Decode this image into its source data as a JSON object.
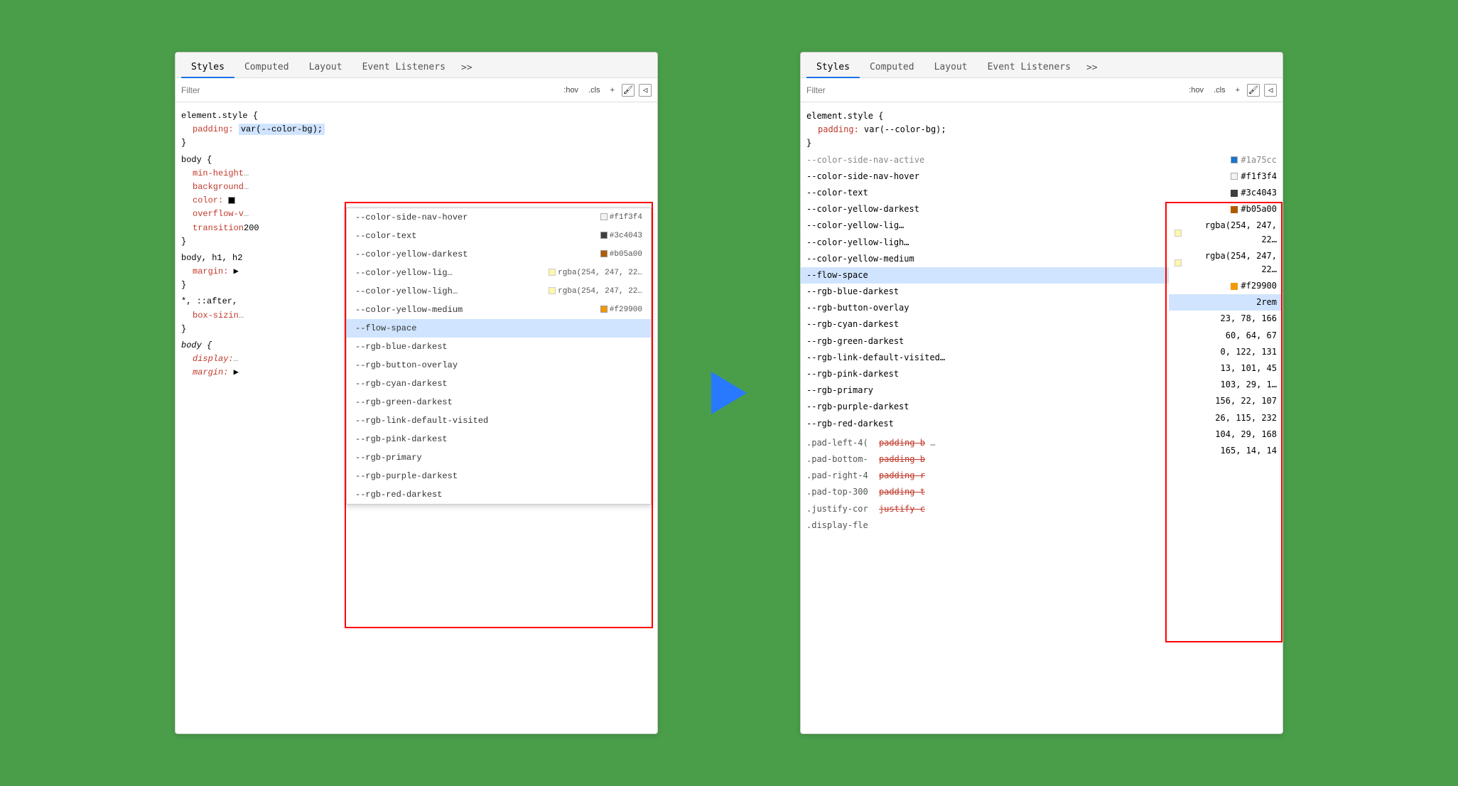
{
  "left_panel": {
    "tabs": [
      "Styles",
      "Computed",
      "Layout",
      "Event Listeners",
      ">>"
    ],
    "active_tab": "Styles",
    "filter_placeholder": "Filter",
    "filter_buttons": [
      ":hov",
      ".cls",
      "+"
    ],
    "styles_content": [
      {
        "type": "rule",
        "selector": "element.style {",
        "props": [
          {
            "name": "padding:",
            "value": "var(--color-bg);",
            "highlight": true
          }
        ],
        "close": "}"
      },
      {
        "type": "rule",
        "selector": "body {",
        "props": [
          {
            "name": "min-height",
            "value": "",
            "truncated": true
          },
          {
            "name": "background",
            "value": "",
            "truncated": true
          },
          {
            "name": "color:",
            "value": "■",
            "truncated": true
          },
          {
            "name": "overflow-v",
            "value": "",
            "truncated": true
          },
          {
            "name": "transition",
            "value": "200",
            "truncated": true
          }
        ],
        "close": "}"
      },
      {
        "type": "rule",
        "selector": "body, h1, h2",
        "props": [
          {
            "name": "margin:",
            "value": "▶",
            "truncated": true
          }
        ],
        "close": "}"
      },
      {
        "type": "rule",
        "selector": "*, ::after,",
        "props": [
          {
            "name": "box-sizin",
            "value": "",
            "truncated": true
          }
        ],
        "close": "}"
      },
      {
        "type": "rule",
        "selector": "body {",
        "italic": true,
        "props": [
          {
            "name": "display:",
            "value": "",
            "truncated": true
          },
          {
            "name": "margin:",
            "value": "▶",
            "truncated": true
          }
        ]
      }
    ],
    "autocomplete": {
      "items": [
        {
          "name": "--color-side-nav-hover",
          "value": "#f1f3f4",
          "swatch": "#f1f3f4",
          "swatch_border": true
        },
        {
          "name": "--color-text",
          "value": "#3c4043",
          "swatch": "#3c4043",
          "swatch_border": false
        },
        {
          "name": "--color-yellow-darkest",
          "value": "#b05a00",
          "swatch": "#b05a00",
          "swatch_border": false
        },
        {
          "name": "--color-yellow-lig…",
          "value": "rgba(254, 247, 22…",
          "swatch": "#fef722",
          "swatch_border": true
        },
        {
          "name": "--color-yellow-ligh…",
          "value": "rgba(254, 247, 22…",
          "swatch": "#fef722",
          "swatch_border": true
        },
        {
          "name": "--color-yellow-medium",
          "value": "#f29900",
          "swatch": "#f29900",
          "swatch_border": false
        },
        {
          "name": "--flow-space",
          "value": "",
          "highlighted": true
        },
        {
          "name": "--rgb-blue-darkest",
          "value": ""
        },
        {
          "name": "--rgb-button-overlay",
          "value": ""
        },
        {
          "name": "--rgb-cyan-darkest",
          "value": ""
        },
        {
          "name": "--rgb-green-darkest",
          "value": ""
        },
        {
          "name": "--rgb-link-default-visited",
          "value": ""
        },
        {
          "name": "--rgb-pink-darkest",
          "value": ""
        },
        {
          "name": "--rgb-primary",
          "value": ""
        },
        {
          "name": "--rgb-purple-darkest",
          "value": ""
        },
        {
          "name": "--rgb-red-darkest",
          "value": ""
        }
      ]
    }
  },
  "right_panel": {
    "tabs": [
      "Styles",
      "Computed",
      "Layout",
      "Event Listeners",
      ">>"
    ],
    "active_tab": "Styles",
    "filter_placeholder": "Filter",
    "filter_buttons": [
      ":hov",
      ".cls",
      "+"
    ],
    "styles_top": [
      {
        "selector": "element.style {",
        "props": [
          {
            "name": "padding:",
            "value": "var(--color-bg);"
          }
        ],
        "close": "}"
      }
    ],
    "computed_rows_top": [
      {
        "name": "--color-side-nav-active",
        "value": "#1a75cc",
        "swatch": "#1a75cc",
        "truncated": true
      },
      {
        "name": "--color-side-nav-hover",
        "value": "#f1f3f4",
        "swatch": "#f1f3f4",
        "swatch_border": true
      },
      {
        "name": "--color-text",
        "value": "#3c4043",
        "swatch": "#3c4043"
      },
      {
        "name": "--color-yellow-darkest",
        "value": "#b05a00",
        "swatch": "#b05a00"
      },
      {
        "name": "--color-yellow-lig…",
        "value": "rgba(254, 247, 22…",
        "swatch": "#fef722",
        "swatch_border": true
      },
      {
        "name": "--color-yellow-ligh…",
        "value": "rgba(254, 247, 22…",
        "swatch": "#fef722",
        "swatch_border": true
      },
      {
        "name": "--color-yellow-medium",
        "value": "#f29900",
        "swatch": "#f29900"
      },
      {
        "name": "--flow-space",
        "value": "2rem",
        "highlighted": true
      },
      {
        "name": "--rgb-blue-darkest",
        "value": "23, 78, 166"
      },
      {
        "name": "--rgb-button-overlay",
        "value": "60, 64, 67"
      },
      {
        "name": "--rgb-cyan-darkest",
        "value": "0, 122, 131"
      },
      {
        "name": "--rgb-green-darkest",
        "value": "13, 101, 45"
      },
      {
        "name": "--rgb-link-default-visited…",
        "value": "103, 29, 1…"
      },
      {
        "name": "--rgb-pink-darkest",
        "value": "156, 22, 107"
      },
      {
        "name": "--rgb-primary",
        "value": "26, 115, 232"
      },
      {
        "name": "--rgb-purple-darkest",
        "value": "104, 29, 168"
      },
      {
        "name": "--rgb-red-darkest",
        "value": "165, 14, 14"
      }
    ],
    "pad_rules": [
      {
        "selector": ".pad-left-4(",
        "prop": "padding-b",
        "truncated": true
      },
      {
        "selector": ".pad-bottom-",
        "prop": "padding-b",
        "truncated": true
      },
      {
        "selector": ".pad-right-4",
        "prop": "padding-r",
        "truncated": true
      },
      {
        "selector": ".pad-top-300",
        "prop": "padding-t",
        "truncated": true
      },
      {
        "selector": ".justify-cor",
        "prop": "justify-c",
        "truncated": true
      },
      {
        "selector": ".display-fle",
        "prop": "",
        "truncated": true
      }
    ]
  }
}
